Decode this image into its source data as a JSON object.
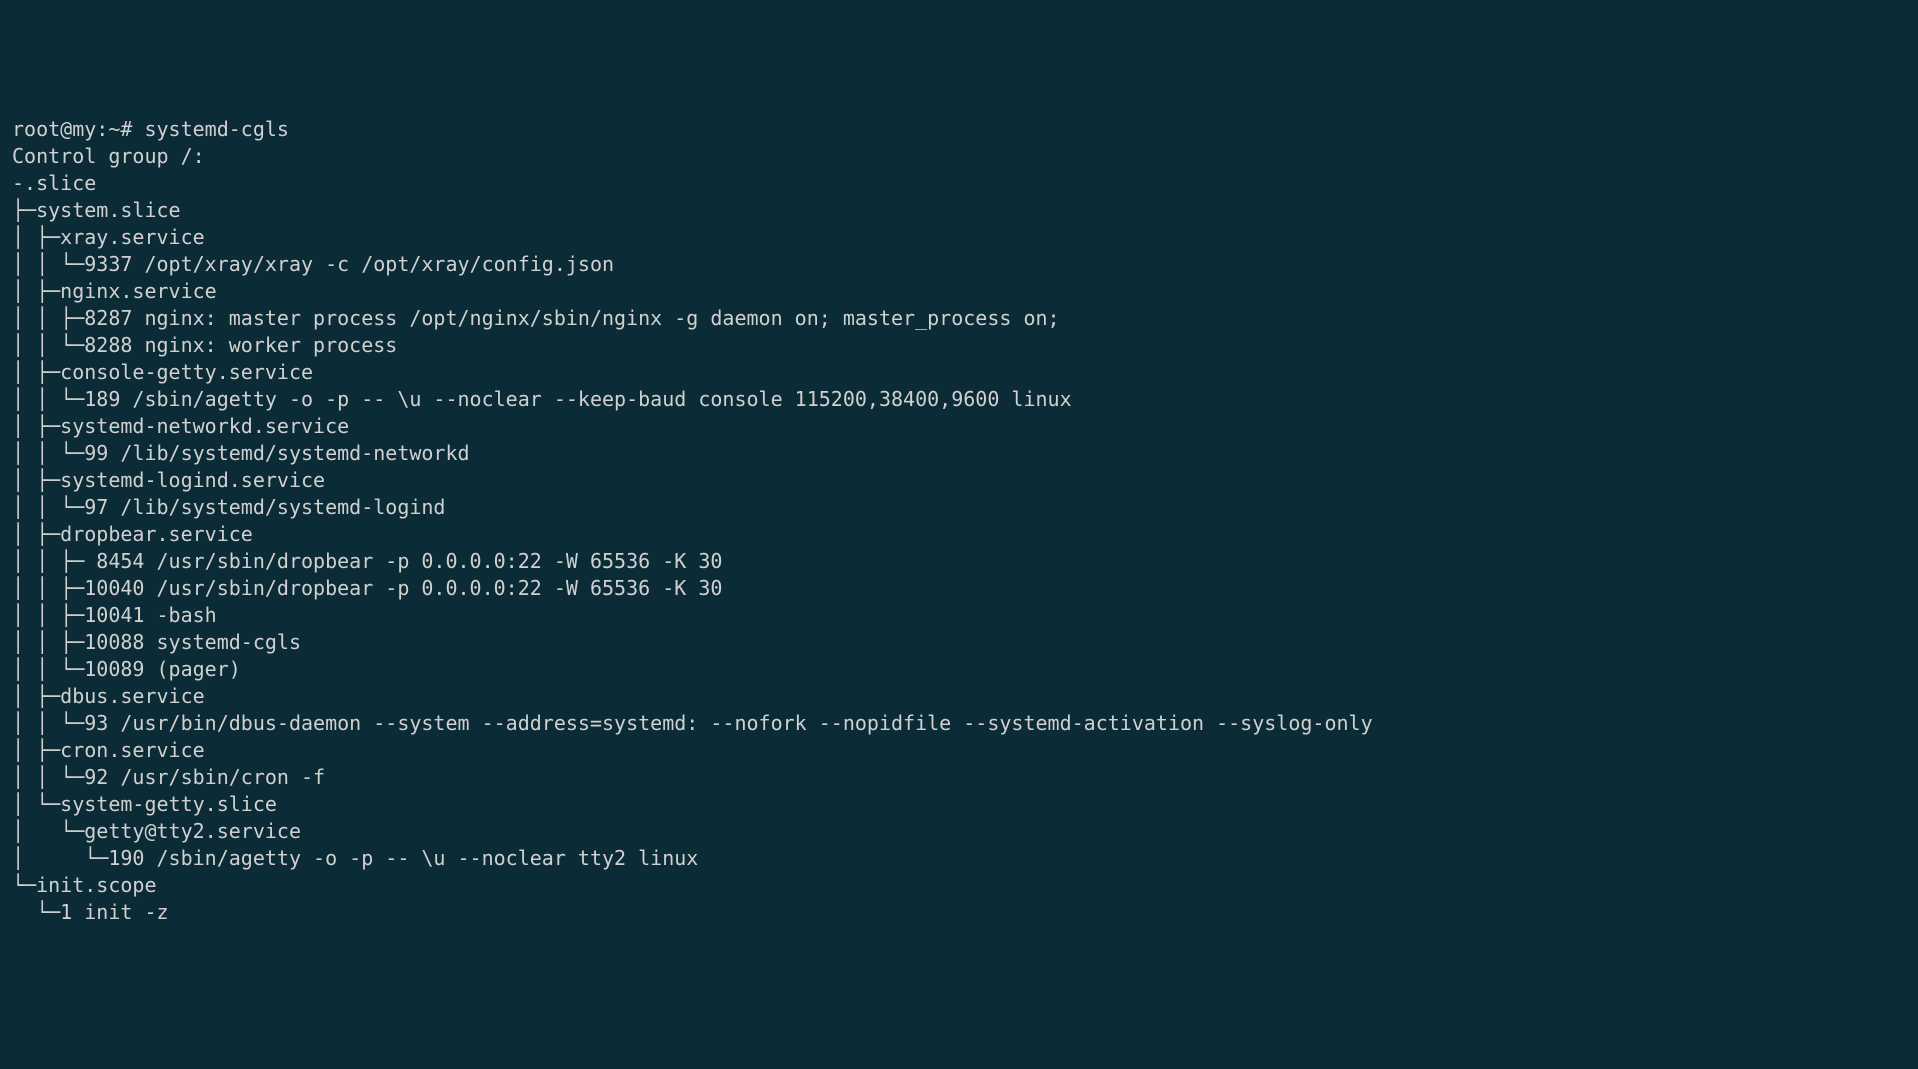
{
  "prompt": "root@my:~# ",
  "command": "systemd-cgls",
  "lines": [
    "Control group /:",
    "-.slice",
    "├─system.slice",
    "│ ├─xray.service",
    "│ │ └─9337 /opt/xray/xray -c /opt/xray/config.json",
    "│ ├─nginx.service",
    "│ │ ├─8287 nginx: master process /opt/nginx/sbin/nginx -g daemon on; master_process on;",
    "│ │ └─8288 nginx: worker process",
    "│ ├─console-getty.service",
    "│ │ └─189 /sbin/agetty -o -p -- \\u --noclear --keep-baud console 115200,38400,9600 linux",
    "│ ├─systemd-networkd.service",
    "│ │ └─99 /lib/systemd/systemd-networkd",
    "│ ├─systemd-logind.service",
    "│ │ └─97 /lib/systemd/systemd-logind",
    "│ ├─dropbear.service",
    "│ │ ├─ 8454 /usr/sbin/dropbear -p 0.0.0.0:22 -W 65536 -K 30",
    "│ │ ├─10040 /usr/sbin/dropbear -p 0.0.0.0:22 -W 65536 -K 30",
    "│ │ ├─10041 -bash",
    "│ │ ├─10088 systemd-cgls",
    "│ │ └─10089 (pager)",
    "│ ├─dbus.service",
    "│ │ └─93 /usr/bin/dbus-daemon --system --address=systemd: --nofork --nopidfile --systemd-activation --syslog-only",
    "│ ├─cron.service",
    "│ │ └─92 /usr/sbin/cron -f",
    "│ └─system-getty.slice",
    "│   └─getty@tty2.service",
    "│     └─190 /sbin/agetty -o -p -- \\u --noclear tty2 linux",
    "└─init.scope",
    "  └─1 init -z"
  ]
}
